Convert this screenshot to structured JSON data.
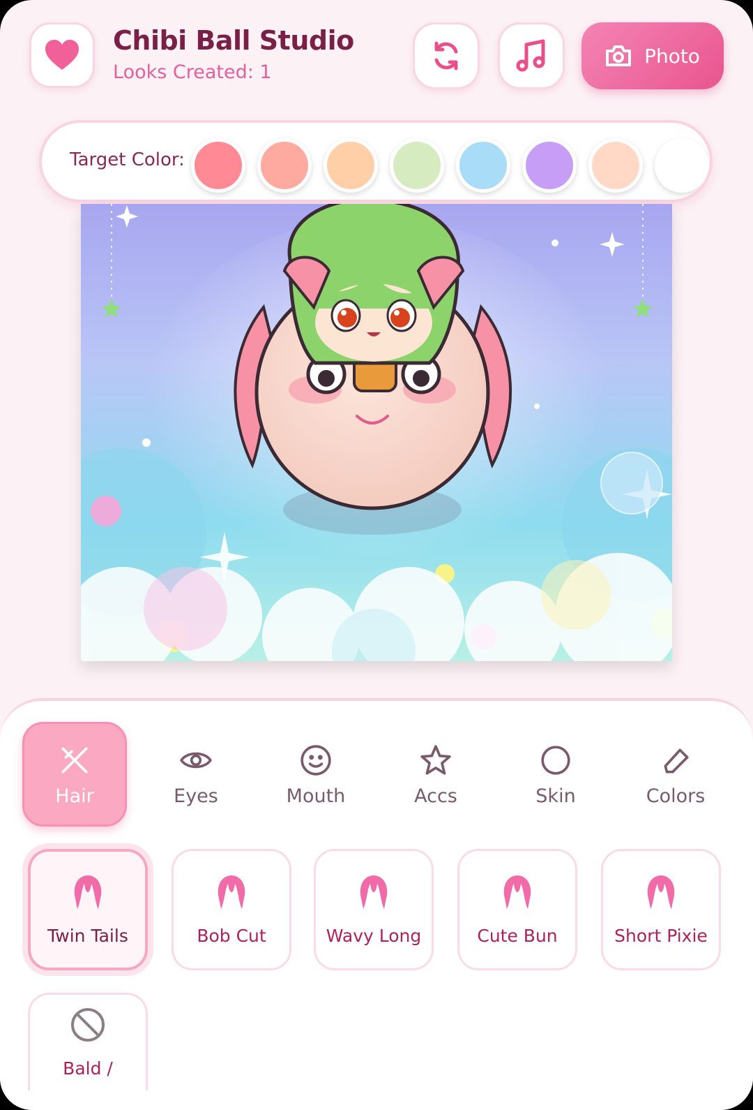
{
  "header": {
    "title": "Chibi Ball Studio",
    "subtitle": "Looks Created: 1",
    "photo_label": "Photo"
  },
  "target_color": {
    "label": "Target Color:",
    "swatches": [
      "#ff8a95",
      "#ffaaa0",
      "#ffcfa8",
      "#d6ecc0",
      "#a9ddf7",
      "#c79ef6",
      "#ffd9c6",
      "#ffffff"
    ]
  },
  "tabs": [
    {
      "label": "Hair",
      "icon": "scissors-icon",
      "active": true
    },
    {
      "label": "Eyes",
      "icon": "eye-icon"
    },
    {
      "label": "Mouth",
      "icon": "smile-icon"
    },
    {
      "label": "Accs",
      "icon": "star-icon"
    },
    {
      "label": "Skin",
      "icon": "circle-icon"
    },
    {
      "label": "Colors",
      "icon": "eraser-icon"
    }
  ],
  "hair_options": [
    {
      "label": "Twin Tails",
      "icon": "hair-icon",
      "selected": true
    },
    {
      "label": "Bob Cut",
      "icon": "hair-icon"
    },
    {
      "label": "Wavy Long",
      "icon": "hair-icon"
    },
    {
      "label": "Cute Bun",
      "icon": "hair-icon"
    },
    {
      "label": "Short Pixie",
      "icon": "hair-icon"
    },
    {
      "label": "Bald /",
      "icon": "prohibited-icon"
    }
  ],
  "colors": {
    "accent": "#e9558e",
    "title": "#7a1f45",
    "border": "#fad3e1"
  }
}
